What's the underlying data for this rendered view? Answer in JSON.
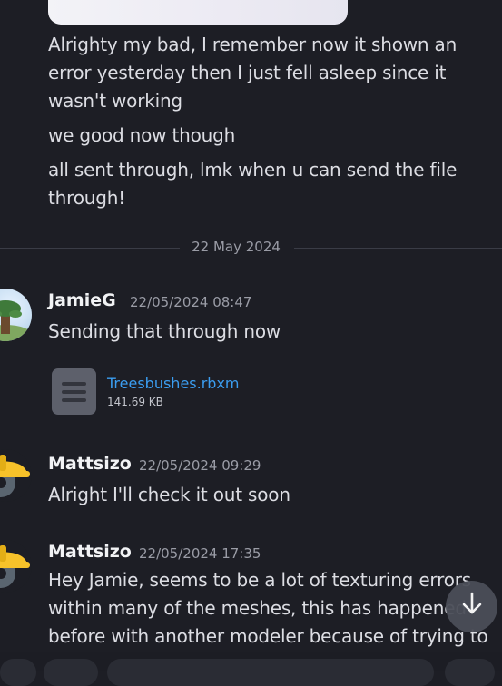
{
  "messages_top": [
    "Alrighty my bad, I remember now it shown an error yesterday then I just fell asleep since it wasn't working",
    "we good now though",
    "all sent through, lmk when u can send the file through!"
  ],
  "date_divider": "22 May 2024",
  "posts": [
    {
      "author": "JamieG",
      "timestamp": "22/05/2024 08:47",
      "text": "Sending that through now",
      "attachment": {
        "filename": "Treesbushes.rbxm",
        "size": "141.69 KB"
      }
    },
    {
      "author": "Mattsizo",
      "timestamp": "22/05/2024 09:29",
      "text": "Alright I'll check it out soon"
    },
    {
      "author": "Mattsizo",
      "timestamp": "22/05/2024 17:35",
      "text": "Hey Jamie, seems to be a lot of texturing errors within many of the meshes, this has happened before with another modeler because of trying to"
    }
  ],
  "icons": {
    "scroll_down": "arrow-down-icon",
    "file": "file-icon",
    "avatar_matt": "hardhat-gear-avatar"
  },
  "colors": {
    "background": "#1d1e25",
    "link": "#3b9df0",
    "avatar_yellow": "#f7c22a"
  }
}
